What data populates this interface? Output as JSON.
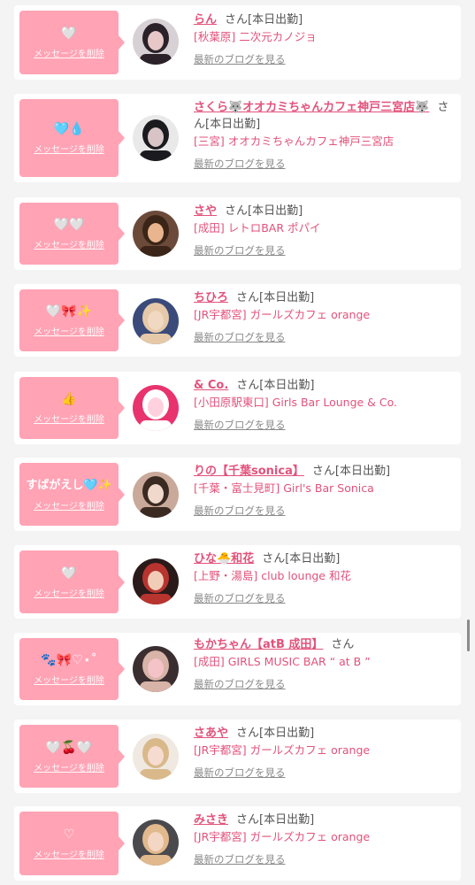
{
  "delete_label": "メッセージを削除",
  "blog_label": "最新のブログを見る",
  "san": "さん",
  "colors": {
    "bubble": "#ffa3b5",
    "name": "#e2527b",
    "background": "#f4f4f4"
  },
  "items": [
    {
      "message": "🤍",
      "name": "らん",
      "status": "[本日出勤]",
      "shop": "[秋葉原] 二次元カノジョ",
      "avatar": {
        "bg": "#d7d0d4",
        "fg": "#2a2228",
        "accent": "#e8c7c9"
      }
    },
    {
      "message": "🩵💧",
      "name": "さくら🐺オオカミちゃんカフェ神戸三宮店🐺",
      "status": "[本日出勤]",
      "shop": "[三宮] オオカミちゃんカフェ神戸三宮店",
      "avatar": {
        "bg": "#e9e9ea",
        "fg": "#1b1b1f",
        "accent": "#d8c4c6"
      }
    },
    {
      "message": "🤍🤍",
      "name": "さや",
      "status": "[本日出勤]",
      "shop": "[成田] レトロBAR ポパイ",
      "avatar": {
        "bg": "#6b4a3a",
        "fg": "#3a2518",
        "accent": "#e9b58f"
      }
    },
    {
      "message": "🤍🎀✨",
      "name": "ちひろ",
      "status": "[本日出勤]",
      "shop": "[JR宇都宮] ガールズカフェ orange",
      "avatar": {
        "bg": "#3a4a7a",
        "fg": "#e6c9a8",
        "accent": "#f1d8c2"
      }
    },
    {
      "message": "👍",
      "name": "& Co.",
      "status": "[本日出勤]",
      "shop": "[小田原駅東口] Girls Bar Lounge & Co.",
      "avatar": {
        "bg": "#e8336e",
        "fg": "#ffffff",
        "accent": "#ffd1df"
      }
    },
    {
      "message": "すばがえし🩵✨",
      "message_is_text": true,
      "name": "りの【千葉sonica】",
      "status": "[本日出勤]",
      "shop": "[千葉・富士見町] Girl's Bar Sonica",
      "avatar": {
        "bg": "#c9a99a",
        "fg": "#3a2a22",
        "accent": "#f0d9cc"
      }
    },
    {
      "message": "🤍",
      "name": "ひな🐣和花",
      "status": "[本日出勤]",
      "shop": "[上野・湯島] club lounge 和花",
      "avatar": {
        "bg": "#2a1a1a",
        "fg": "#b8342f",
        "accent": "#f1cdb8"
      }
    },
    {
      "message": "🐾🎀♡⋆˚",
      "name": "もかちゃん【atB 成田】",
      "status": "",
      "shop": "[成田] GIRLS MUSIC BAR “ at B ”",
      "avatar": {
        "bg": "#3a2e30",
        "fg": "#d8b3a8",
        "accent": "#f3c3c8"
      }
    },
    {
      "message": "🤍🍒🤍",
      "name": "さあや",
      "status": "[本日出勤]",
      "shop": "[JR宇都宮] ガールズカフェ orange",
      "avatar": {
        "bg": "#efe9e2",
        "fg": "#d9b98a",
        "accent": "#f6dcd0"
      }
    },
    {
      "message": "♡",
      "name": "みさき",
      "status": "[本日出勤]",
      "shop": "[JR宇都宮] ガールズカフェ orange",
      "avatar": {
        "bg": "#4a4a4e",
        "fg": "#e2b98c",
        "accent": "#f4d6c4"
      }
    }
  ]
}
